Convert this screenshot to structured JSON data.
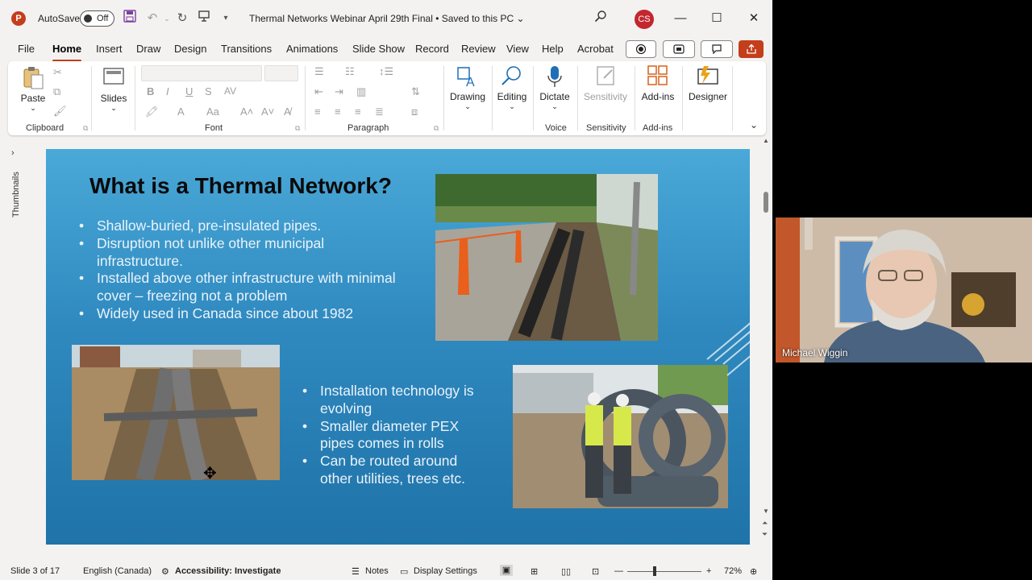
{
  "titlebar": {
    "app_icon": "P",
    "autosave_label": "AutoSave",
    "autosave_state": "Off",
    "document_title": "Thermal Networks Webinar April 29th Final • Saved to this PC ⌄",
    "user_initials": "CS"
  },
  "menu": {
    "items": [
      "File",
      "Home",
      "Insert",
      "Draw",
      "Design",
      "Transitions",
      "Animations",
      "Slide Show",
      "Record",
      "Review",
      "View",
      "Help",
      "Acrobat"
    ],
    "active": "Home"
  },
  "ribbon": {
    "paste": "Paste",
    "clipboard_group": "Clipboard",
    "slides": "Slides",
    "font_group": "Font",
    "paragraph_group": "Paragraph",
    "drawing": "Drawing",
    "editing": "Editing",
    "dictate": "Dictate",
    "voice_group": "Voice",
    "sensitivity": "Sensitivity",
    "sensitivity_group": "Sensitivity",
    "addins": "Add-ins",
    "addins_group": "Add-ins",
    "designer": "Designer"
  },
  "thumbnails_label": "Thumbnails",
  "slide": {
    "title": "What is a Thermal Network?",
    "bullets_top": [
      "Shallow-buried, pre-insulated pipes.",
      "Disruption not unlike other municipal infrastructure.",
      "Installed above other infrastructure with minimal cover – freezing not a problem",
      "Widely used in Canada since about 1982"
    ],
    "bullets_bottom": [
      "Installation technology is evolving",
      "Smaller diameter PEX pipes comes in  rolls",
      "Can be routed around other utilities, trees etc."
    ]
  },
  "status": {
    "slide_info": "Slide 3 of 17",
    "language": "English (Canada)",
    "accessibility": "Accessibility: Investigate",
    "notes": "Notes",
    "display_settings": "Display Settings",
    "zoom": "72%"
  },
  "webcam": {
    "participant_name": "Michael Wiggin"
  },
  "colors": {
    "accent": "#c43e1c",
    "slide_blue": "#2f89bf",
    "avatar": "#c4262e"
  }
}
